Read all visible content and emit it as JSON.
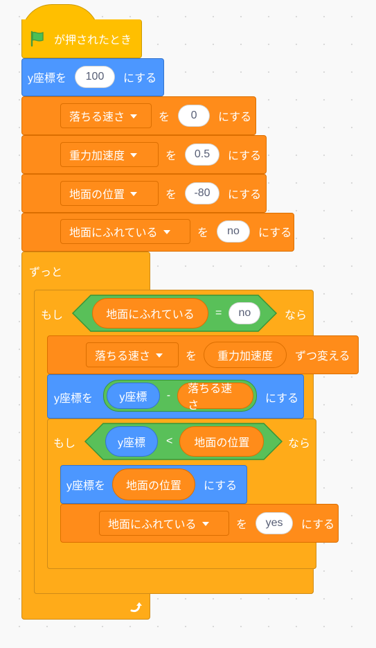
{
  "hat": {
    "label": "が押されたとき",
    "icon": "green-flag-icon"
  },
  "set_y": {
    "prefix": "y座標を",
    "value": "100",
    "suffix": "にする"
  },
  "set_vars": [
    {
      "var": "落ちる速さ",
      "particle": "を",
      "value": "0",
      "suffix": "にする"
    },
    {
      "var": "重力加速度",
      "particle": "を",
      "value": "0.5",
      "suffix": "にする"
    },
    {
      "var": "地面の位置",
      "particle": "を",
      "value": "-80",
      "suffix": "にする"
    },
    {
      "var": "地面にふれている",
      "particle": "を",
      "value": "no",
      "suffix": "にする"
    }
  ],
  "forever": {
    "label": "ずっと",
    "loop_icon": "loop-arrow-icon"
  },
  "if1": {
    "label": "もし",
    "then": "なら",
    "left": "地面にふれている",
    "op": "=",
    "right": "no"
  },
  "change": {
    "var": "落ちる速さ",
    "particle": "を",
    "by": "重力加速度",
    "suffix": "ずつ変える"
  },
  "set_y2": {
    "prefix": "y座標を",
    "left": "y座標",
    "op": "-",
    "right": "落ちる速さ",
    "suffix": "にする"
  },
  "if2": {
    "label": "もし",
    "then": "なら",
    "left": "y座標",
    "op": "<",
    "right": "地面の位置"
  },
  "set_y3": {
    "prefix": "y座標を",
    "value": "地面の位置",
    "suffix": "にする"
  },
  "set_touch": {
    "var": "地面にふれている",
    "particle": "を",
    "value": "yes",
    "suffix": "にする"
  },
  "colors": {
    "events": "#ffbf00",
    "motion": "#4c97ff",
    "variables": "#ff8c1a",
    "control": "#ffab19",
    "operators": "#59c059"
  }
}
